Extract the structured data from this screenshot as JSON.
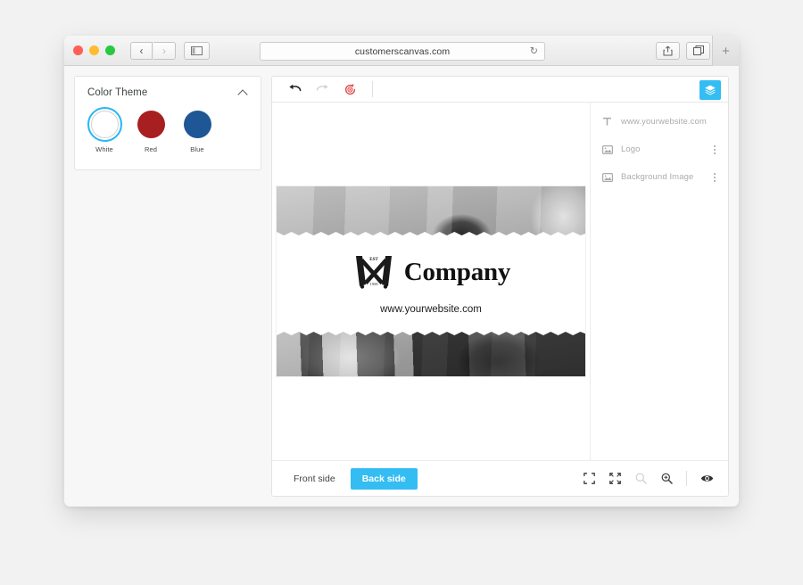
{
  "browser": {
    "url": "customerscanvas.com",
    "back_label": "‹",
    "forward_label": "›",
    "reload_label": "↻",
    "newtab_label": "+",
    "icons": {
      "sidebar": "sidebar-toggle-icon",
      "share": "share-icon",
      "tabs": "tab-overview-icon"
    }
  },
  "sidebar": {
    "panel": {
      "title": "Color Theme",
      "collapse_icon": "chevron-up-icon",
      "swatches": [
        {
          "label": "White",
          "color": "#ffffff",
          "selected": true
        },
        {
          "label": "Red",
          "color": "#a81f22",
          "selected": false
        },
        {
          "label": "Blue",
          "color": "#1f5695",
          "selected": false
        }
      ]
    }
  },
  "editor": {
    "toolbar": {
      "undo_label": "undo-icon",
      "redo_label": "redo-icon",
      "reset_label": "reset-history-icon",
      "layers_toggle_label": "layers-icon"
    },
    "card": {
      "brand_name": "Company",
      "url": "www.yourwebsite.com",
      "logo_est": "EST",
      "logo_year": "1958"
    },
    "layers": {
      "items": [
        {
          "name": "www.yourwebsite.com",
          "icon": "text-layer-icon",
          "has_menu": false
        },
        {
          "name": "Logo",
          "icon": "image-layer-icon",
          "has_menu": true
        },
        {
          "name": "Background Image",
          "icon": "image-layer-icon",
          "has_menu": true
        }
      ]
    },
    "bottom": {
      "tabs": [
        {
          "label": "Front side",
          "active": false
        },
        {
          "label": "Back side",
          "active": true
        }
      ],
      "tools": [
        {
          "name": "fit-to-frame-icon",
          "disabled": false
        },
        {
          "name": "fullscreen-icon",
          "disabled": false
        },
        {
          "name": "zoom-out-icon",
          "disabled": true
        },
        {
          "name": "zoom-in-icon",
          "disabled": false
        },
        {
          "name": "preview-eye-icon",
          "disabled": false
        }
      ]
    }
  },
  "theme": {
    "accent": "#34bdf2",
    "selected_ring": "#29b6f6"
  }
}
